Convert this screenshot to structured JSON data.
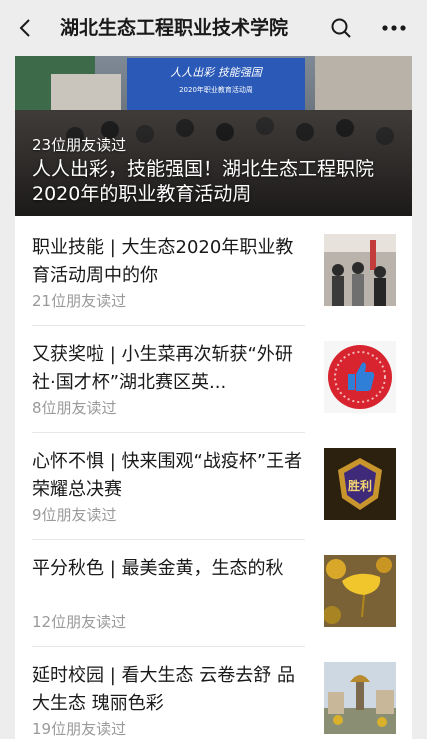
{
  "header": {
    "title": "湖北生态工程职业技术学院",
    "back_icon": "chevron-left-icon",
    "search_icon": "search-icon",
    "more_icon": "more-dots-icon"
  },
  "hero": {
    "reads": "23位朋友读过",
    "title": "人人出彩，技能强国！湖北生态工程职院2020年的职业教育活动周",
    "banner_text": "人人出彩 技能强国",
    "banner_subtext": "2020年职业教育活动周"
  },
  "articles": [
    {
      "title": "职业技能 | 大生态2020年职业教育活动周中的你",
      "reads": "21位朋友读过"
    },
    {
      "title": "又获奖啦 | 小生菜再次斩获“外研社·国才杯”湖北赛区英...",
      "reads": "8位朋友读过"
    },
    {
      "title": "心怀不惧 | 快来围观“战疫杯”王者荣耀总决赛",
      "reads": "9位朋友读过"
    },
    {
      "title": "平分秋色 | 最美金黄，生态的秋",
      "reads": "12位朋友读过"
    },
    {
      "title": "延时校园 | 看大生态 云卷去舒 品大生态 瑰丽色彩",
      "reads": "19位朋友读过"
    }
  ],
  "thumb_icons": [
    "crowd-photo-icon",
    "thumbs-up-badge-icon",
    "game-emblem-icon",
    "ginkgo-leaf-icon",
    "campus-statue-icon"
  ],
  "thumb_text": {
    "game": "胜利"
  },
  "colors": {
    "background": "#ededed",
    "card": "#ffffff",
    "text": "#191919",
    "muted": "#9a9a9a"
  }
}
